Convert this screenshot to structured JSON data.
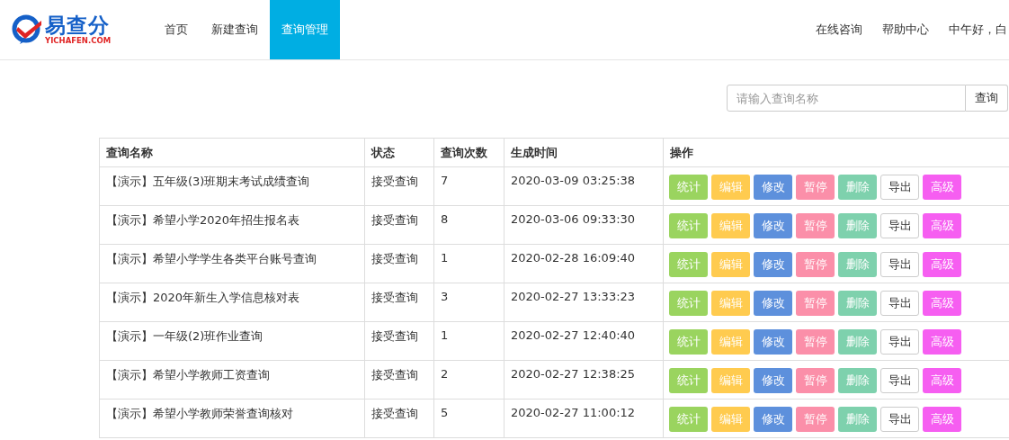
{
  "logo": {
    "name": "易查分",
    "domain": "YICHAFEN.COM"
  },
  "nav": [
    {
      "label": "首页",
      "selected": false
    },
    {
      "label": "新建查询",
      "selected": false
    },
    {
      "label": "查询管理",
      "selected": true
    }
  ],
  "top_links": [
    "在线咨询",
    "帮助中心"
  ],
  "greeting": "中午好，白",
  "search": {
    "placeholder": "请输入查询名称",
    "button": "查询"
  },
  "table": {
    "columns": [
      "查询名称",
      "状态",
      "查询次数",
      "生成时间",
      "操作"
    ],
    "rows": [
      {
        "name": "【演示】五年级(3)班期末考试成绩查询",
        "status": "接受查询",
        "count": "7",
        "time": "2020-03-09 03:25:38",
        "actions": [
          {
            "label": "统计",
            "kind": "stat"
          },
          {
            "label": "编辑",
            "kind": "edit"
          },
          {
            "label": "修改",
            "kind": "modify"
          },
          {
            "label": "暂停",
            "kind": "pause"
          },
          {
            "label": "删除",
            "kind": "delete"
          },
          {
            "label": "导出",
            "kind": "export"
          },
          {
            "label": "高级",
            "kind": "advanced"
          }
        ]
      },
      {
        "name": "【演示】希望小学2020年招生报名表",
        "status": "接受查询",
        "count": "8",
        "time": "2020-03-06 09:33:30",
        "actions": [
          {
            "label": "统计",
            "kind": "stat"
          },
          {
            "label": "编辑",
            "kind": "edit"
          },
          {
            "label": "修改",
            "kind": "modify"
          },
          {
            "label": "暂停",
            "kind": "pause"
          },
          {
            "label": "删除",
            "kind": "delete"
          },
          {
            "label": "导出",
            "kind": "export"
          },
          {
            "label": "高级",
            "kind": "advanced"
          }
        ]
      },
      {
        "name": "【演示】希望小学学生各类平台账号查询",
        "status": "接受查询",
        "count": "1",
        "time": "2020-02-28 16:09:40",
        "actions": [
          {
            "label": "统计",
            "kind": "stat"
          },
          {
            "label": "编辑",
            "kind": "edit"
          },
          {
            "label": "修改",
            "kind": "modify"
          },
          {
            "label": "暂停",
            "kind": "pause"
          },
          {
            "label": "删除",
            "kind": "delete"
          },
          {
            "label": "导出",
            "kind": "export"
          },
          {
            "label": "高级",
            "kind": "advanced"
          }
        ]
      },
      {
        "name": "【演示】2020年新生入学信息核对表",
        "status": "接受查询",
        "count": "3",
        "time": "2020-02-27 13:33:23",
        "actions": [
          {
            "label": "统计",
            "kind": "stat"
          },
          {
            "label": "编辑",
            "kind": "edit"
          },
          {
            "label": "修改",
            "kind": "modify"
          },
          {
            "label": "暂停",
            "kind": "pause"
          },
          {
            "label": "删除",
            "kind": "delete"
          },
          {
            "label": "导出",
            "kind": "export"
          },
          {
            "label": "高级",
            "kind": "advanced"
          }
        ]
      },
      {
        "name": "【演示】一年级(2)班作业查询",
        "status": "接受查询",
        "count": "1",
        "time": "2020-02-27 12:40:40",
        "actions": [
          {
            "label": "统计",
            "kind": "stat"
          },
          {
            "label": "编辑",
            "kind": "edit"
          },
          {
            "label": "修改",
            "kind": "modify"
          },
          {
            "label": "暂停",
            "kind": "pause"
          },
          {
            "label": "删除",
            "kind": "delete"
          },
          {
            "label": "导出",
            "kind": "export"
          },
          {
            "label": "高级",
            "kind": "advanced"
          }
        ]
      },
      {
        "name": "【演示】希望小学教师工资查询",
        "status": "接受查询",
        "count": "2",
        "time": "2020-02-27 12:38:25",
        "actions": [
          {
            "label": "统计",
            "kind": "stat"
          },
          {
            "label": "编辑",
            "kind": "edit"
          },
          {
            "label": "修改",
            "kind": "modify"
          },
          {
            "label": "暂停",
            "kind": "pause"
          },
          {
            "label": "删除",
            "kind": "delete"
          },
          {
            "label": "导出",
            "kind": "export"
          },
          {
            "label": "高级",
            "kind": "advanced"
          }
        ]
      },
      {
        "name": "【演示】希望小学教师荣誉查询核对",
        "status": "接受查询",
        "count": "5",
        "time": "2020-02-27 11:00:12",
        "actions": [
          {
            "label": "统计",
            "kind": "stat"
          },
          {
            "label": "编辑",
            "kind": "edit"
          },
          {
            "label": "修改",
            "kind": "modify"
          },
          {
            "label": "暂停",
            "kind": "pause"
          },
          {
            "label": "删除",
            "kind": "delete"
          },
          {
            "label": "导出",
            "kind": "export"
          },
          {
            "label": "高级",
            "kind": "advanced"
          }
        ]
      }
    ]
  }
}
